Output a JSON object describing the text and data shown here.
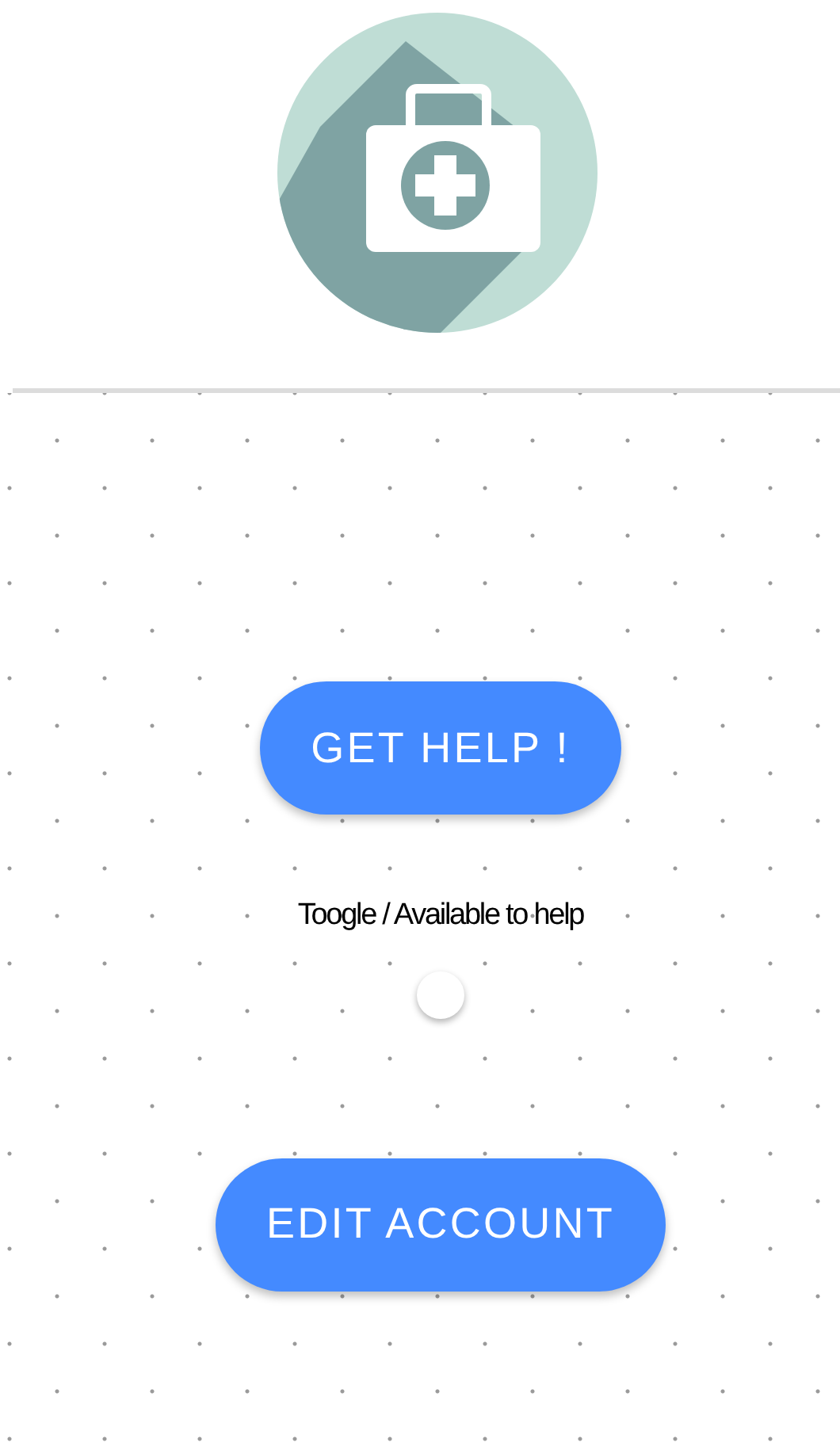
{
  "buttons": [
    {
      "label": "GET HELP !"
    }
  ],
  "toggle": {
    "label": "Toogle / Available to help",
    "on": false
  },
  "secondary_buttons": [
    {
      "label": "EDIT ACCOUNT"
    }
  ]
}
